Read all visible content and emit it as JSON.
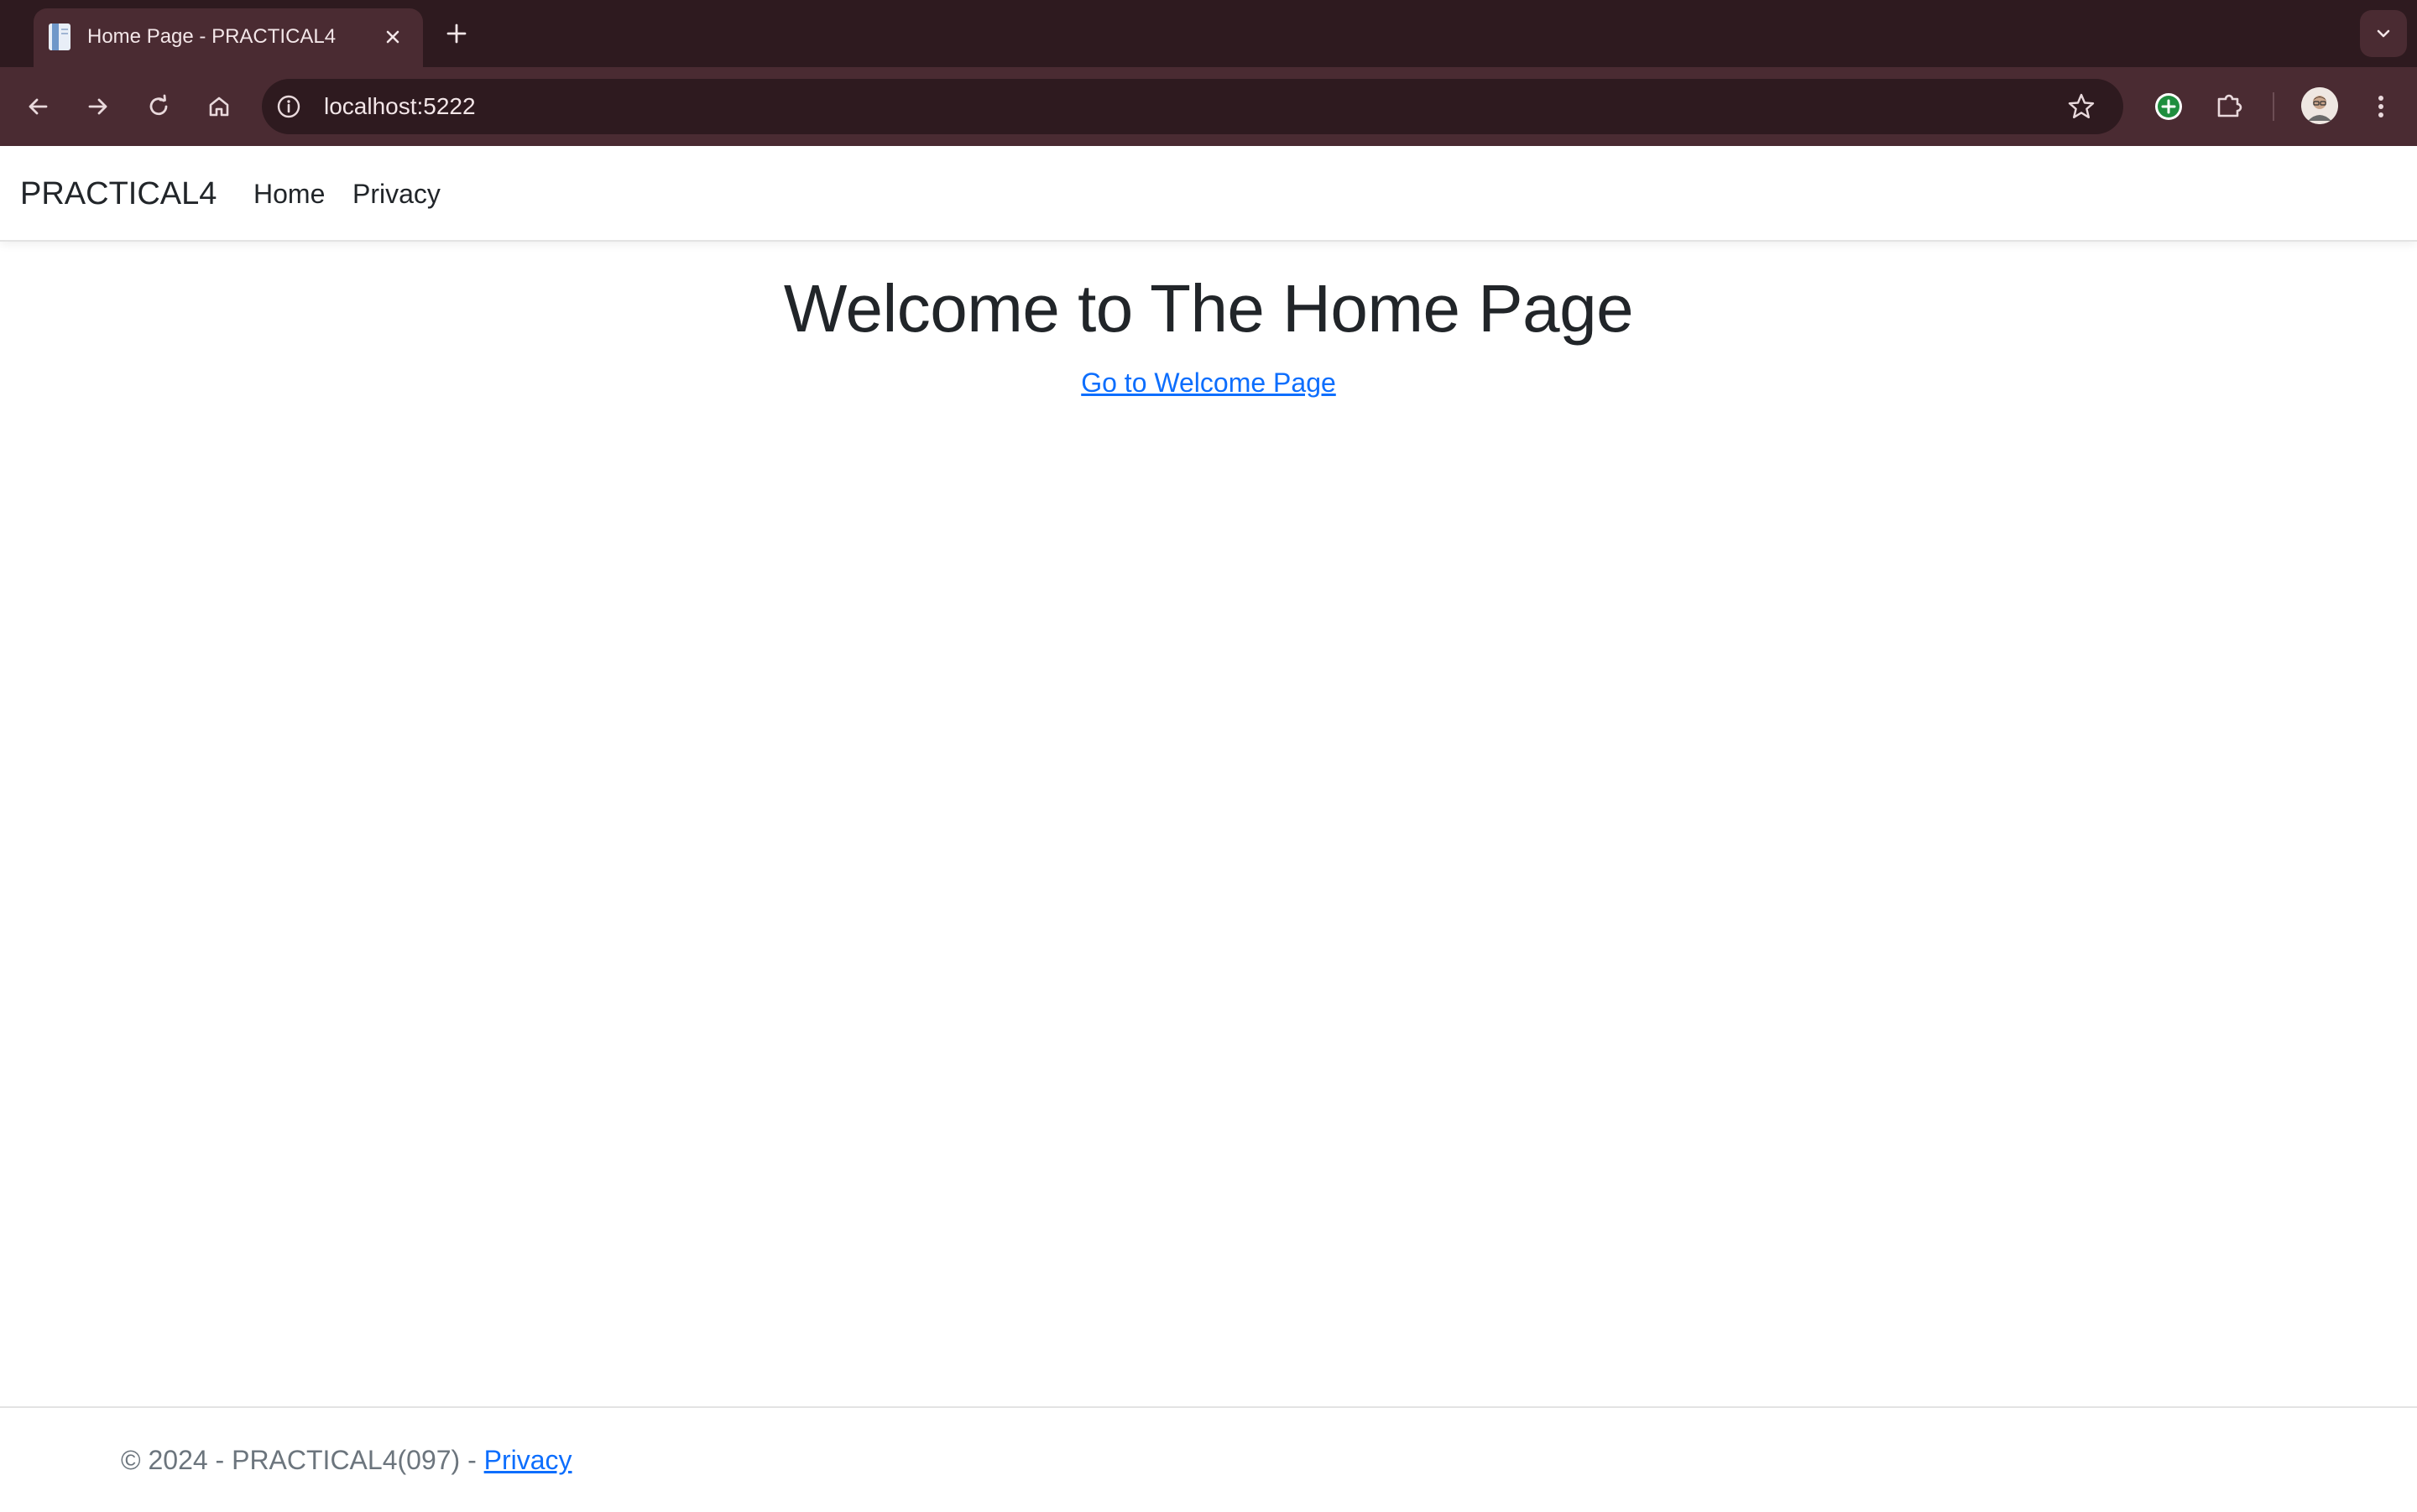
{
  "browser": {
    "tab": {
      "title": "Home Page - PRACTICAL4",
      "close_icon": "close-icon",
      "favicon": "page-favicon-icon"
    },
    "new_tab_icon": "plus-icon",
    "tab_search_icon": "chevron-down-icon",
    "toolbar": {
      "back_icon": "back-arrow-icon",
      "forward_icon": "forward-arrow-icon",
      "reload_icon": "reload-icon",
      "home_icon": "home-icon",
      "site_info_icon": "info-icon",
      "url": "localhost:5222",
      "bookmark_icon": "star-icon",
      "extension_add_icon": "plus-circle-icon",
      "extensions_icon": "puzzle-icon",
      "menu_icon": "kebab-menu-icon"
    },
    "colors": {
      "frame": "#2e1a1f",
      "toolbar": "#4a2b32",
      "text": "#f3e6e8"
    }
  },
  "navbar": {
    "brand": "PRACTICAL4",
    "links": [
      "Home",
      "Privacy"
    ]
  },
  "main": {
    "heading": "Welcome to The Home Page",
    "link": "Go to Welcome Page"
  },
  "footer": {
    "text": "© 2024 - PRACTICAL4(097) - ",
    "link": "Privacy"
  },
  "colors": {
    "link": "#0d6efd",
    "text": "#212529",
    "muted": "#6c757d"
  }
}
